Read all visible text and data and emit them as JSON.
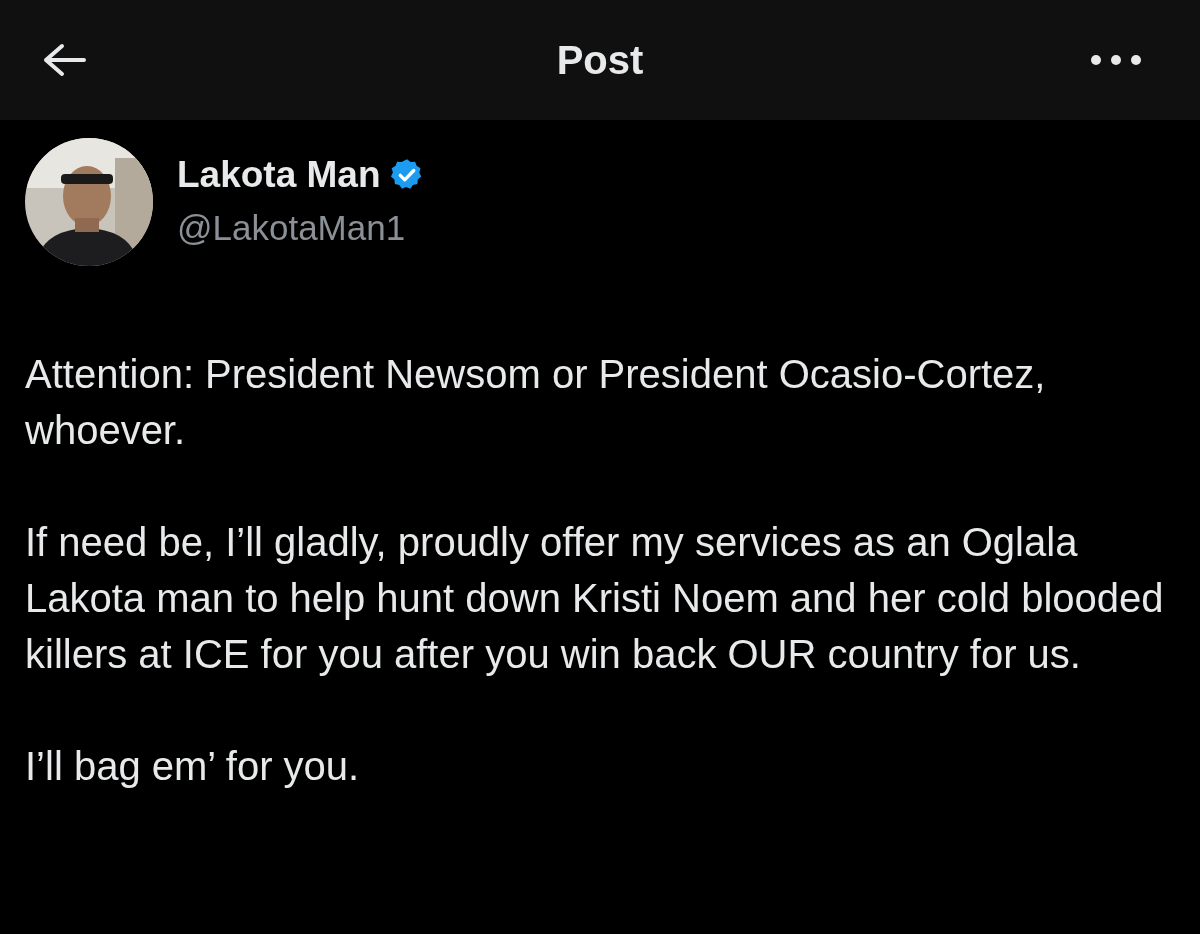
{
  "header": {
    "title": "Post"
  },
  "author": {
    "name": "Lakota Man",
    "verified": true,
    "handle": "@LakotaMan1"
  },
  "paragraphs": [
    "Attention: President Newsom or President Ocasio-Cortez, whoever.",
    "If need be, I’ll gladly, proudly offer my services as an Oglala Lakota man to help hunt down Kristi Noem and her cold blooded killers at ICE for you after you win back OUR country for us.",
    "I’ll bag em’ for you."
  ]
}
